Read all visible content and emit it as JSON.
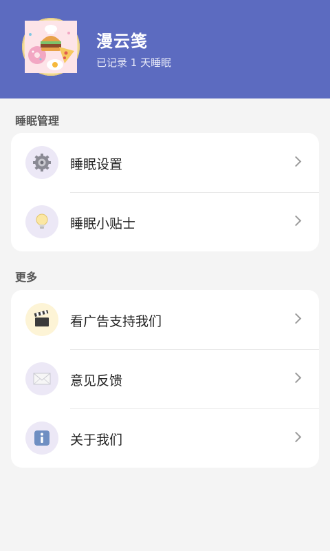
{
  "profile": {
    "name": "漫云笺",
    "record_text": "已记录 1 天睡眠",
    "avatar_icon": "food-avatar-image"
  },
  "sections": [
    {
      "title": "睡眠管理",
      "items": [
        {
          "label": "睡眠设置",
          "icon": "gear-icon"
        },
        {
          "label": "睡眠小贴士",
          "icon": "lightbulb-icon"
        }
      ]
    },
    {
      "title": "更多",
      "items": [
        {
          "label": "看广告支持我们",
          "icon": "clapperboard-icon"
        },
        {
          "label": "意见反馈",
          "icon": "envelope-icon"
        },
        {
          "label": "关于我们",
          "icon": "info-icon"
        }
      ]
    }
  ],
  "colors": {
    "header": "#5c6bc0",
    "background": "#f4f4f4",
    "card": "#ffffff",
    "icon_bg_purple": "#ece8f6",
    "icon_bg_yellow": "#fdf4d6"
  }
}
